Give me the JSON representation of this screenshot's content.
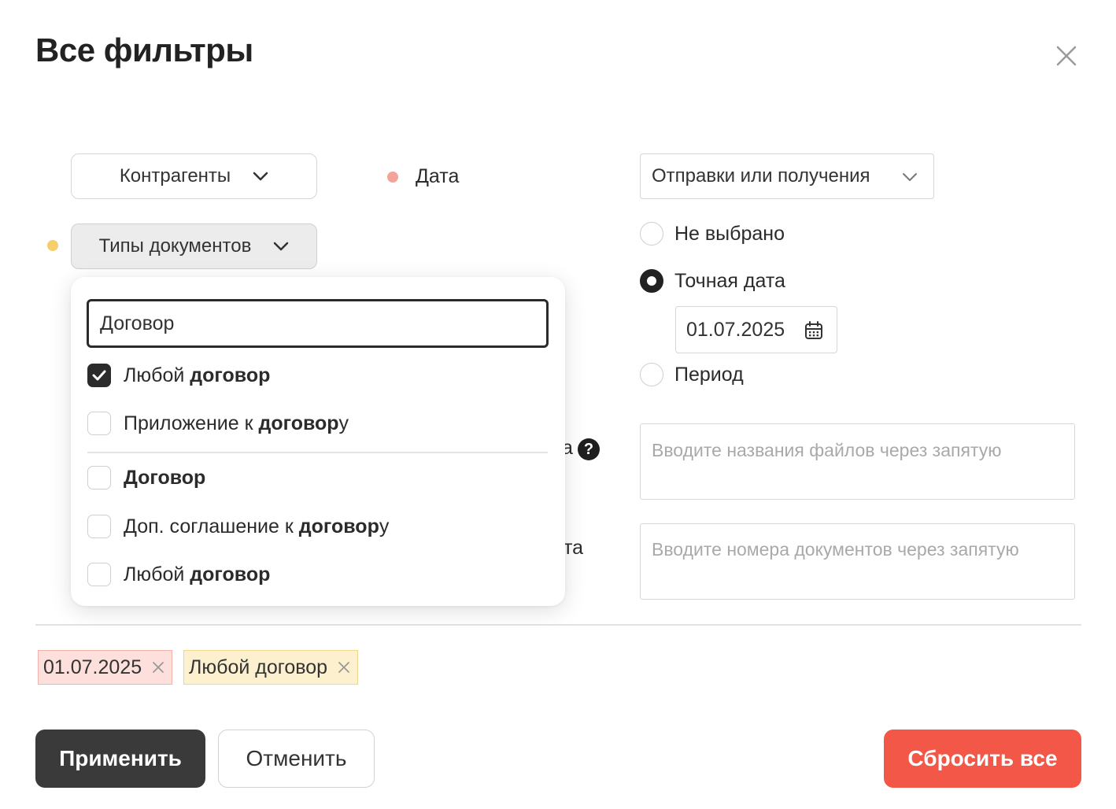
{
  "modal": {
    "title": "Все фильтры"
  },
  "filters": {
    "counterparties_label": "Контрагенты",
    "doc_types_label": "Типы документов",
    "date_label": "Дата",
    "date_kind_value": "Отправки или получения",
    "date_options": [
      "Не выбрано",
      "Точная дата",
      "Период"
    ],
    "date_selected": "Точная дата",
    "exact_date_value": "01.07.2025",
    "filenames_label_fragment": "а",
    "filenames_placeholder": "Вводите названия файлов через запятую",
    "numbers_label_fragment": "та",
    "numbers_placeholder": "Вводите номера документов через запятую",
    "help_icon_glyph": "?",
    "colors": {
      "date_dot": "#f4a39a",
      "doctype_dot": "#f6cf6b"
    }
  },
  "doc_types_dropdown": {
    "search_value": "Договор",
    "options": [
      {
        "pre": "Любой ",
        "bold": "договор",
        "post": "",
        "checked": true
      },
      {
        "pre": "Приложение к ",
        "bold": "договор",
        "post": "у",
        "checked": false
      },
      {
        "pre": "",
        "bold": "Договор",
        "post": "",
        "checked": false
      },
      {
        "pre": "Доп. соглашение к ",
        "bold": "договор",
        "post": "у",
        "checked": false
      },
      {
        "pre": "Любой ",
        "bold": "договор",
        "post": "",
        "checked": false
      }
    ]
  },
  "applied_chips": [
    {
      "label": "01.07.2025",
      "color": "#fde0dc",
      "border": "#f3b3aa"
    },
    {
      "label": "Любой договор",
      "color": "#fdf0cf",
      "border": "#f2d78e"
    }
  ],
  "actions": {
    "apply": "Применить",
    "cancel": "Отменить",
    "reset_all": "Сбросить все"
  }
}
